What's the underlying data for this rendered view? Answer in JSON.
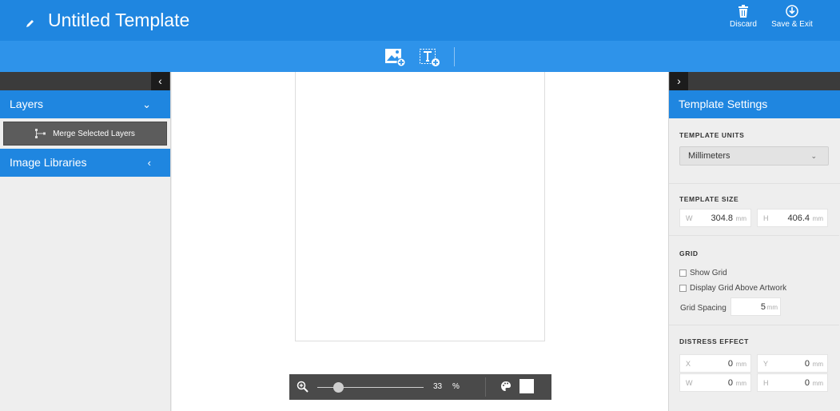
{
  "header": {
    "title": "Untitled Template",
    "discard_label": "Discard",
    "save_exit_label": "Save & Exit",
    "accent": "#1f86e0"
  },
  "toolbar": {
    "icons": [
      "add-image-icon",
      "add-text-icon"
    ]
  },
  "left_panel": {
    "layers_label": "Layers",
    "merge_label": "Merge Selected Layers",
    "image_libraries_label": "Image Libraries"
  },
  "zoom": {
    "value": "33",
    "unit": "%",
    "slider_fraction": 0.33
  },
  "right_panel": {
    "title": "Template Settings",
    "units_label": "TEMPLATE UNITS",
    "units_value": "Millimeters",
    "size_label": "TEMPLATE SIZE",
    "width_label": "W",
    "width_value": "304.8",
    "height_label": "H",
    "height_value": "406.4",
    "unit_suffix": "mm",
    "grid_label": "GRID",
    "show_grid_label": "Show Grid",
    "grid_above_label": "Display Grid Above Artwork",
    "grid_spacing_label": "Grid Spacing",
    "grid_spacing_value": "5",
    "distress_label": "DISTRESS EFFECT",
    "distress_x_label": "X",
    "distress_x_value": "0",
    "distress_y_label": "Y",
    "distress_y_value": "0",
    "distress_w_label": "W",
    "distress_w_value": "0",
    "distress_h_label": "H",
    "distress_h_value": "0"
  }
}
